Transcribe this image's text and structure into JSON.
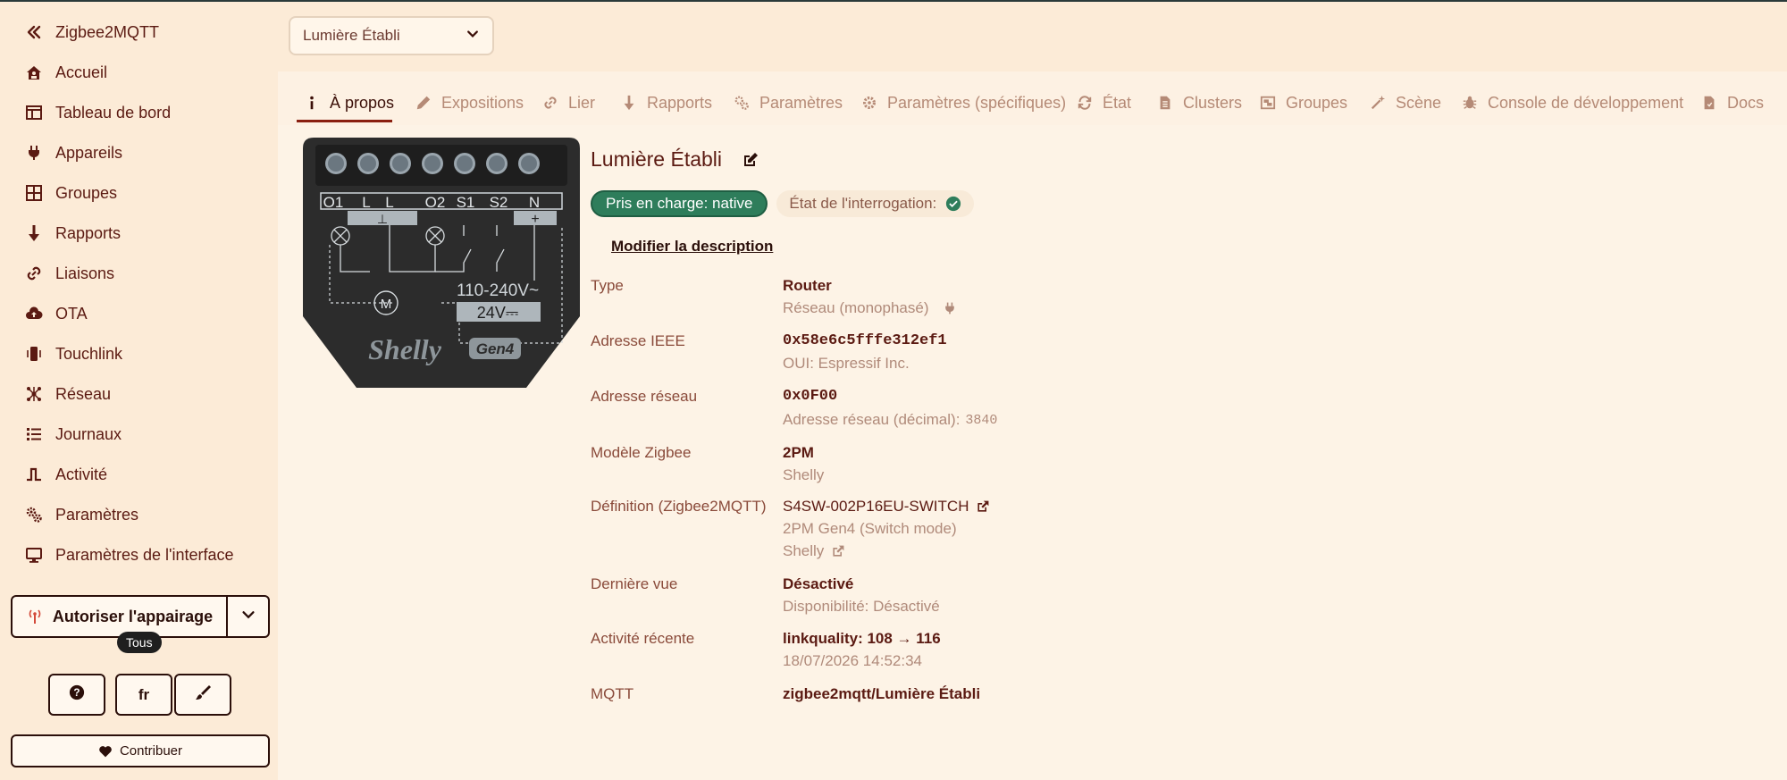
{
  "sidebar": {
    "items": [
      {
        "label": "Zigbee2MQTT",
        "icon": "double-chevron-left-icon"
      },
      {
        "label": "Accueil",
        "icon": "house-icon"
      },
      {
        "label": "Tableau de bord",
        "icon": "dashboard-icon"
      },
      {
        "label": "Appareils",
        "icon": "plug-icon"
      },
      {
        "label": "Groupes",
        "icon": "grid-icon"
      },
      {
        "label": "Rapports",
        "icon": "arrow-down-icon"
      },
      {
        "label": "Liaisons",
        "icon": "link-icon"
      },
      {
        "label": "OTA",
        "icon": "cloud-upload-icon"
      },
      {
        "label": "Touchlink",
        "icon": "mobile-vibrate-icon"
      },
      {
        "label": "Réseau",
        "icon": "network-icon"
      },
      {
        "label": "Journaux",
        "icon": "list-icon"
      },
      {
        "label": "Activité",
        "icon": "pulse-icon"
      },
      {
        "label": "Paramètres",
        "icon": "gears-icon"
      },
      {
        "label": "Paramètres de l'interface",
        "icon": "monitor-icon"
      }
    ],
    "pair_button": "Autoriser l'appairage",
    "pair_tooltip": "Tous",
    "language": "fr",
    "contribute": "Contribuer"
  },
  "header": {
    "device_select": "Lumière Établi"
  },
  "tabs": [
    {
      "label": "À propos",
      "icon": "info-icon",
      "active": true
    },
    {
      "label": "Expositions",
      "icon": "pencil-icon"
    },
    {
      "label": "Lier",
      "icon": "link-icon"
    },
    {
      "label": "Rapports",
      "icon": "arrow-down-icon"
    },
    {
      "label": "Paramètres",
      "icon": "gears-icon"
    },
    {
      "label": "Paramètres (spécifiques)",
      "icon": "gear-icon"
    },
    {
      "label": "État",
      "icon": "refresh-icon"
    },
    {
      "label": "Clusters",
      "icon": "file-icon"
    },
    {
      "label": "Groupes",
      "icon": "object-group-icon"
    },
    {
      "label": "Scène",
      "icon": "magic-wand-icon"
    },
    {
      "label": "Console de développement",
      "icon": "bug-icon"
    },
    {
      "label": "Docs",
      "icon": "document-icon"
    }
  ],
  "device": {
    "title": "Lumière Établi",
    "supported_badge": "Pris en charge: native",
    "polling_badge": "État de l'interrogation:",
    "edit_description": "Modifier la description",
    "image_labels": {
      "brand": "Shelly",
      "gen": "Gen4",
      "terminals": [
        "O1",
        "L",
        "L",
        "O2",
        "S1",
        "S2",
        "N"
      ],
      "voltage_ac": "110-240V~",
      "voltage_dc": "24V⎓",
      "motor": "M"
    },
    "properties": {
      "type": {
        "label": "Type",
        "value": "Router",
        "sub": "Réseau (monophasé)"
      },
      "ieee": {
        "label": "Adresse IEEE",
        "value": "0x58e6c5fffe312ef1",
        "sub": "OUI: Espressif Inc."
      },
      "network": {
        "label": "Adresse réseau",
        "value": "0x0F00",
        "sub_label": "Adresse réseau (décimal):",
        "sub_value": "3840"
      },
      "model": {
        "label": "Modèle Zigbee",
        "value": "2PM",
        "sub": "Shelly"
      },
      "definition": {
        "label": "Définition (Zigbee2MQTT)",
        "value": "S4SW-002P16EU-SWITCH",
        "sub": "2PM Gen4 (Switch mode)",
        "sub2": "Shelly"
      },
      "last_seen": {
        "label": "Dernière vue",
        "value": "Désactivé",
        "sub": "Disponibilité: Désactivé"
      },
      "activity": {
        "label": "Activité récente",
        "value": "linkquality: 108 → 116",
        "sub": "18/07/2026 14:52:34"
      },
      "mqtt": {
        "label": "MQTT",
        "value": "zigbee2mqtt/Lumière Établi"
      }
    }
  },
  "colors": {
    "sidebar_bg": "#fcebd7",
    "main_bg": "#fdf3e6",
    "text": "#5b1a12",
    "accent_green": "#2e7d5b",
    "muted": "#b08a7a"
  }
}
